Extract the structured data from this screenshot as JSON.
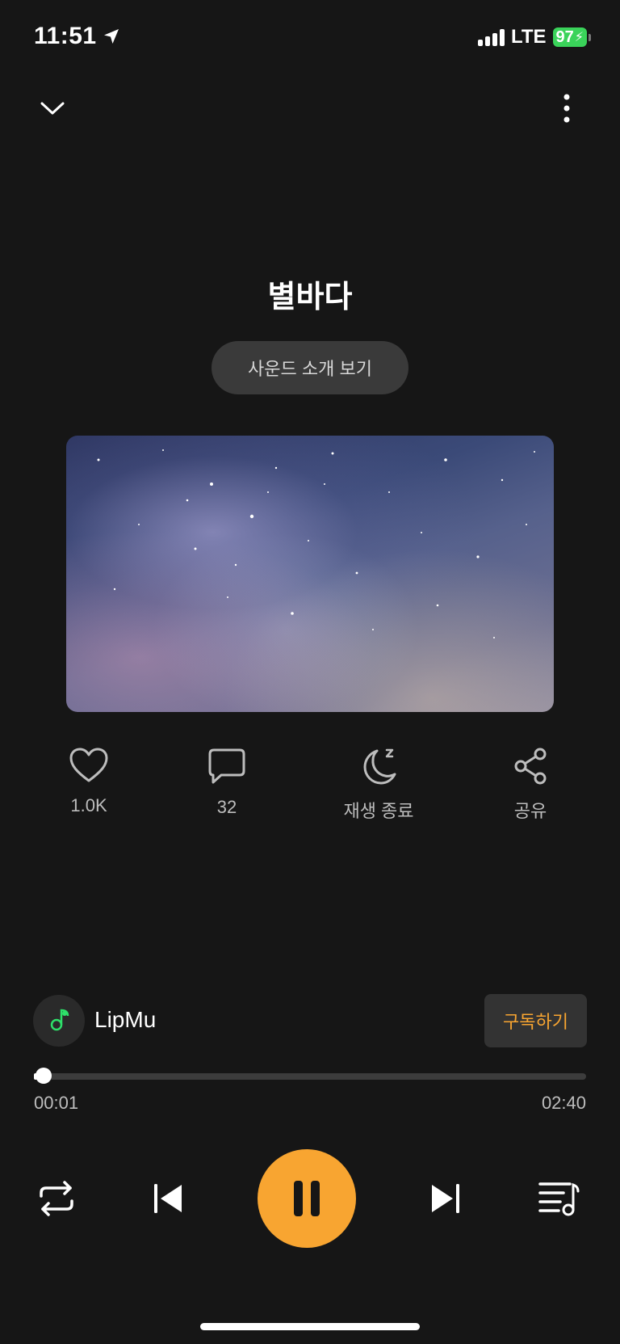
{
  "status_bar": {
    "time": "11:51",
    "network": "LTE",
    "battery": "97"
  },
  "player": {
    "title": "별바다",
    "intro_button": "사운드 소개 보기",
    "actions": [
      {
        "icon": "heart-icon",
        "label": "1.0K"
      },
      {
        "icon": "comment-icon",
        "label": "32"
      },
      {
        "icon": "sleep-timer-icon",
        "label": "재생 종료"
      },
      {
        "icon": "share-icon",
        "label": "공유"
      }
    ],
    "channel": {
      "name": "LipMu",
      "subscribe_label": "구독하기"
    },
    "progress": {
      "current": "00:01",
      "total": "02:40",
      "fraction": 0.006
    },
    "accent_color": "#f8a531"
  }
}
